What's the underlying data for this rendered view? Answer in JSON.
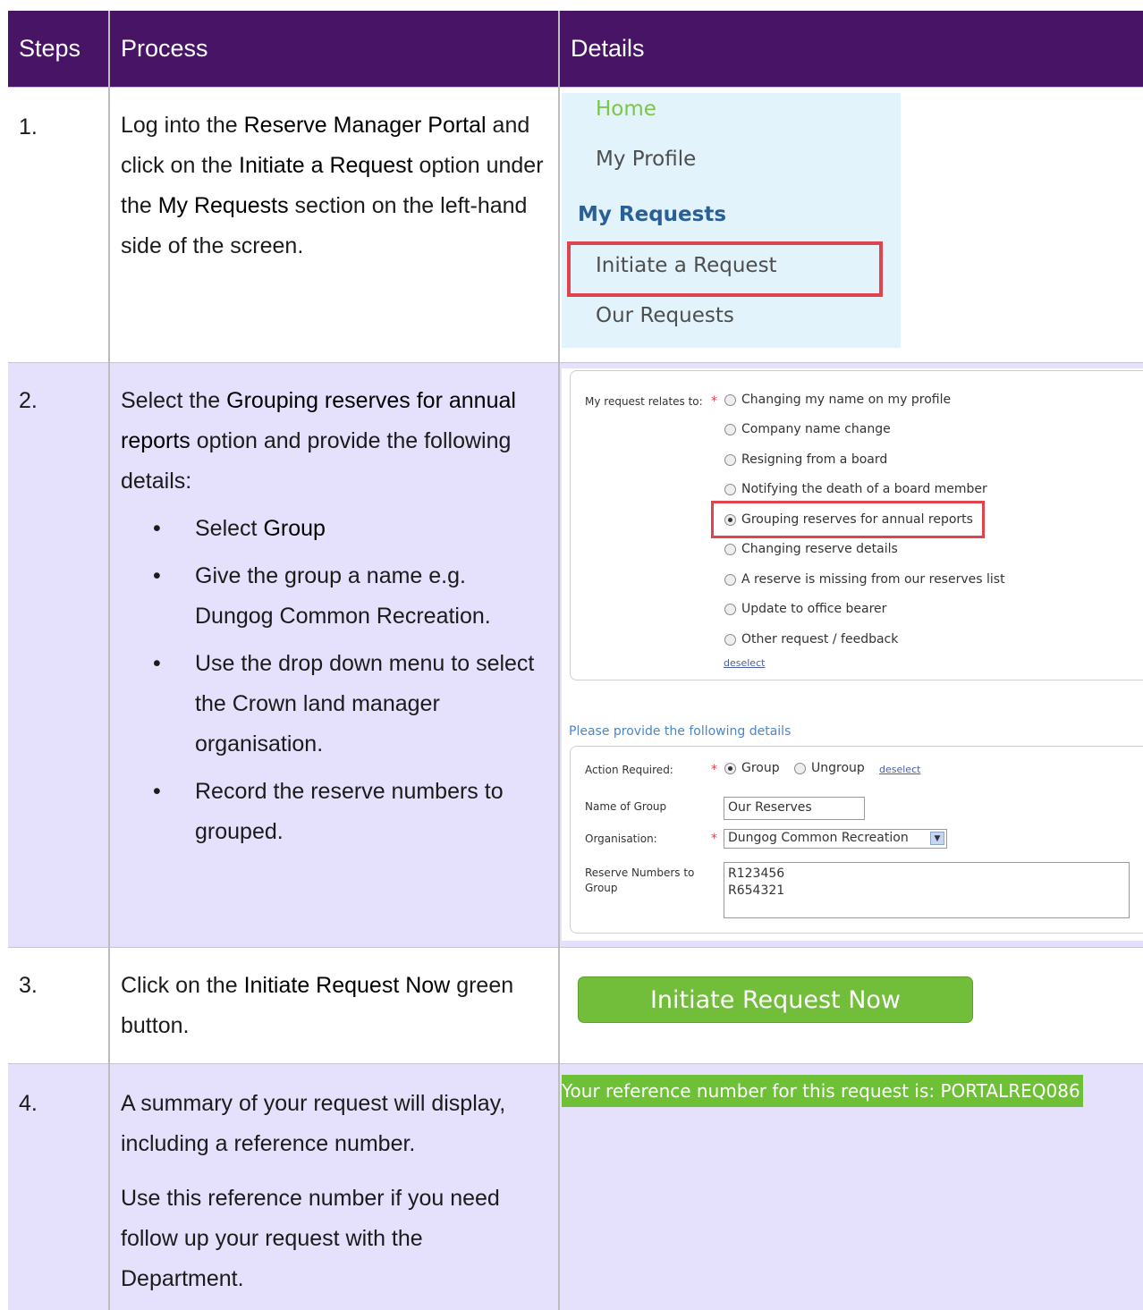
{
  "header": {
    "steps": "Steps",
    "process": "Process",
    "details": "Details"
  },
  "rows": [
    {
      "step": "1.",
      "process_parts": [
        "Log into the ",
        "Reserve Manager Portal",
        " and click on the ",
        "Initiate a Request",
        " option under the ",
        "My Requests",
        " section on the left-hand side of the screen."
      ]
    },
    {
      "step": "2.",
      "intro_parts": [
        "Select the ",
        "Grouping reserves for annual reports",
        " option and provide the following details:"
      ],
      "bullets": [
        {
          "a": "Select ",
          "b": "Group"
        },
        {
          "a": "Give the group a name e.g. Dungog Common Recreation.",
          "b": ""
        },
        {
          "a": "Use the drop down menu to select the Crown land manager organisation.",
          "b": ""
        },
        {
          "a": "Record the reserve numbers to grouped.",
          "b": ""
        }
      ]
    },
    {
      "step": "3.",
      "process_parts": [
        "Click on the ",
        "Initiate Request Now",
        " green button."
      ]
    },
    {
      "step": "4.",
      "p1": "A summary of your request will display, including a reference number.",
      "p2": "Use this reference number if you need follow up your request with the Department."
    }
  ],
  "menu": {
    "home": "Home",
    "profile": "My Profile",
    "section": "My Requests",
    "initiate": "Initiate a Request",
    "ours": "Our Requests",
    "home_color": "#7fc444",
    "section_color": "#2a6096"
  },
  "form": {
    "relates_label": "My request relates to:",
    "options": [
      "Changing my name on my profile",
      "Company name change",
      "Resigning from a board",
      "Notifying the death of a board member",
      "Grouping reserves for annual reports",
      "Changing reserve details",
      "A reserve is missing from our reserves list",
      "Update to office bearer",
      "Other request / feedback"
    ],
    "selected_option": "Grouping reserves for annual reports",
    "deselect": "deselect",
    "provide_details": "Please provide the following details",
    "action_label": "Action Required:",
    "action_group": "Group",
    "action_ungroup": "Ungroup",
    "name_label": "Name of Group",
    "name_value": "Our Reserves",
    "org_label": "Organisation:",
    "org_value": "Dungog Common Recreation",
    "reserve_label": "Reserve Numbers to Group",
    "reserve_values": [
      "R123456",
      "R654321"
    ]
  },
  "button": {
    "label": "Initiate Request Now",
    "color": "#72bd3a"
  },
  "reference": {
    "text": "Your reference number for this request is: PORTALREQ086",
    "color": "#6ec136"
  },
  "colors": {
    "header_bg": "#481466",
    "alt_row_bg": "#e5e0fb",
    "highlight_border": "#e0434b"
  }
}
